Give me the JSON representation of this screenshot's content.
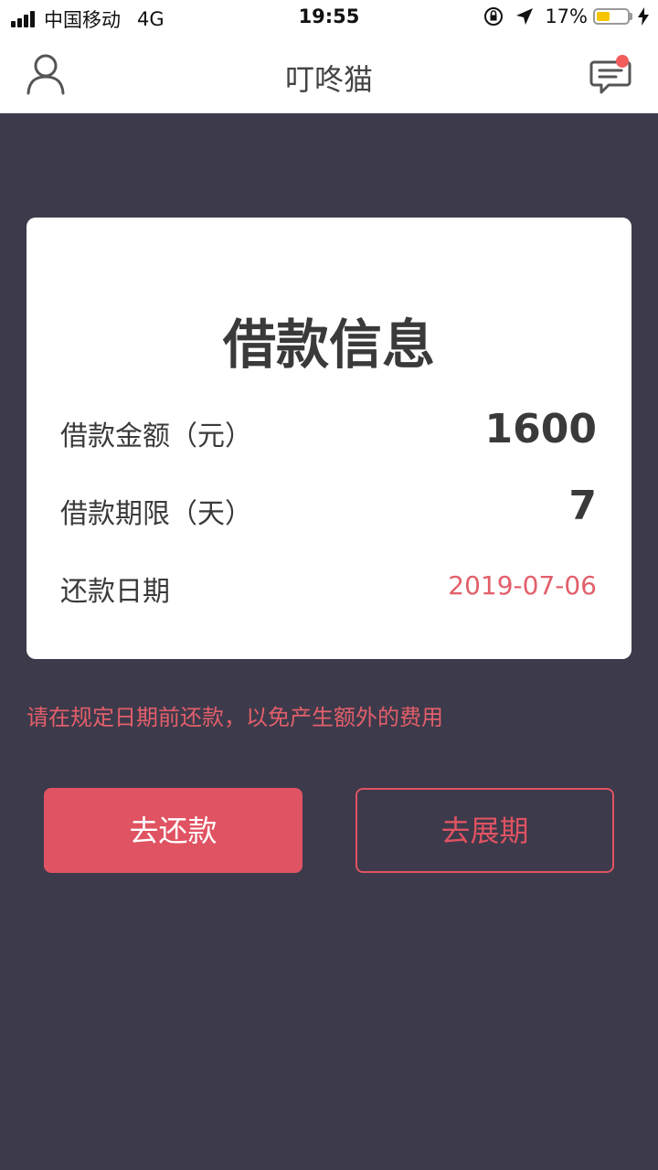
{
  "status_bar": {
    "carrier": "中国移动",
    "network": "4G",
    "time": "19:55",
    "battery": "17%",
    "battery_level": 0.17,
    "icons": [
      "signal-icon",
      "rotation-lock-icon",
      "location-arrow-icon",
      "battery-icon",
      "charging-bolt-icon"
    ]
  },
  "nav": {
    "title": "叮咚猫",
    "left_icon": "user-icon",
    "right_icon": "message-icon",
    "has_unread": true
  },
  "loan_card": {
    "title": "借款信息",
    "rows": [
      {
        "label": "借款金额（元）",
        "value": "1600"
      },
      {
        "label": "借款期限（天）",
        "value": "7"
      },
      {
        "label": "还款日期",
        "value": "2019-07-06"
      }
    ]
  },
  "notice": "请在规定日期前还款，以免产生额外的费用",
  "buttons": {
    "repay": "去还款",
    "extend": "去展期"
  },
  "colors": {
    "background": "#3d3a4b",
    "accent": "#e05362",
    "date_text": "#e25f6a",
    "badge": "#f25c5c"
  }
}
